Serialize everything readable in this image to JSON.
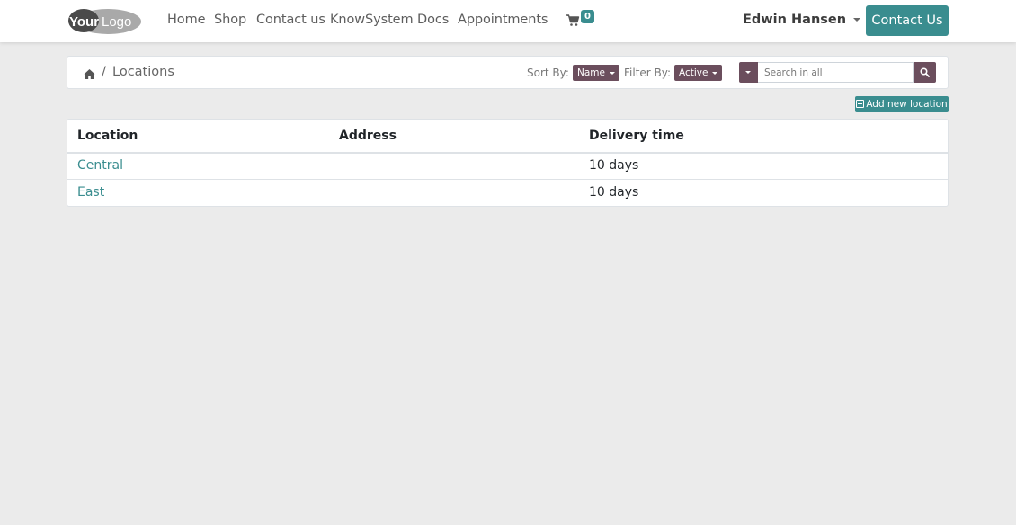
{
  "navbar": {
    "logo_text": "YourLogo",
    "links": [
      {
        "label": "Home"
      },
      {
        "label": "Shop"
      },
      {
        "label": "Contact us"
      },
      {
        "label": "KnowSystem"
      },
      {
        "label": "Docs"
      },
      {
        "label": "Appointments"
      }
    ],
    "cart_icon": "shopping-cart-icon",
    "cart_count": "0",
    "user_name": "Edwin Hansen",
    "contact_button": "Contact Us"
  },
  "breadcrumb": {
    "home_icon": "home-icon",
    "separator": "/",
    "current": "Locations",
    "sort_label": "Sort By:",
    "sort_value": "Name",
    "filter_label": "Filter By:",
    "filter_value": "Active",
    "search_placeholder": "Search in all",
    "search_icon": "search-icon"
  },
  "add_button": "Add new location",
  "table": {
    "columns": [
      "Location",
      "Address",
      "Delivery time"
    ],
    "rows": [
      {
        "location": "Central",
        "address": "",
        "delivery_time": "10 days"
      },
      {
        "location": "East",
        "address": "",
        "delivery_time": "10 days"
      }
    ]
  },
  "colors": {
    "primary": "#3a8d8f",
    "secondary": "#6b4e5d",
    "background": "#ebebeb"
  }
}
